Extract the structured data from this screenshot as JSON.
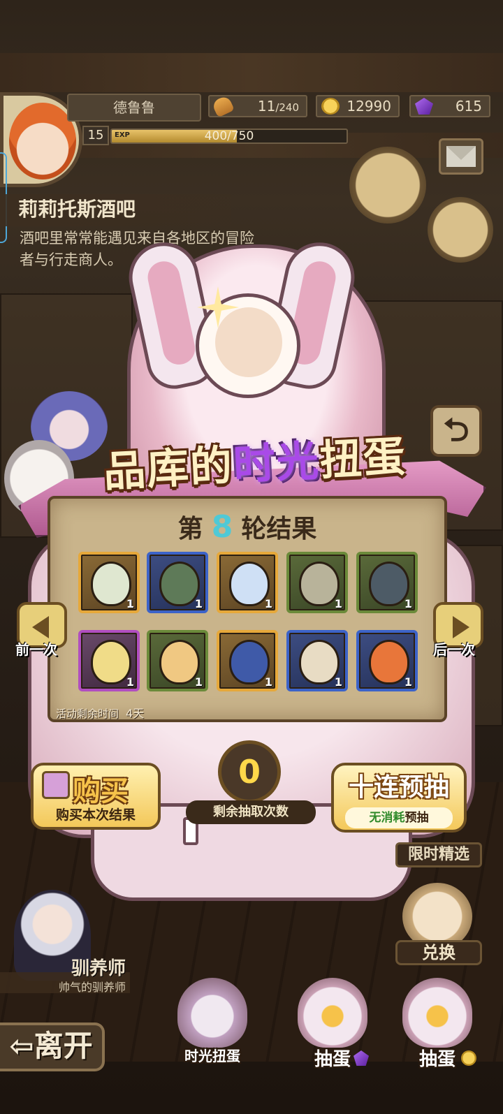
{
  "player": {
    "name": "德鲁鲁",
    "level": "15",
    "exp_tag": "EXP",
    "exp_text": "400/750",
    "exp_fraction": 0.533
  },
  "resources": {
    "bread_current": "11",
    "bread_max": "/240",
    "gold": "12990",
    "gems": "615"
  },
  "location": {
    "title": "莉莉托斯酒吧",
    "description": "酒吧里常常能遇见来自各地区的冒险者与行走商人。"
  },
  "event": {
    "title_prefix": "品库的",
    "title_highlight": "时光",
    "title_suffix": "扭蛋",
    "round_prefix": "第",
    "round_number": "8",
    "round_suffix": "轮结果",
    "remaining_label": "活动剩余时间",
    "remaining_value": "4天",
    "prev_label": "前一次",
    "next_label": "后一次",
    "results": [
      {
        "frame": "gold",
        "icon": "leaf-egg-icon",
        "qty": "1",
        "color": "#dfe7d0"
      },
      {
        "frame": "blue",
        "icon": "hooded-egg-icon",
        "qty": "1",
        "color": "#5e7a58"
      },
      {
        "frame": "gold",
        "icon": "winged-crown-egg-icon",
        "qty": "1",
        "color": "#cfe0f5"
      },
      {
        "frame": "green",
        "icon": "seed-egg-icon",
        "qty": "1",
        "color": "#b8b39a"
      },
      {
        "frame": "green",
        "icon": "shell-egg-icon",
        "qty": "1",
        "color": "#4d5b66"
      },
      {
        "frame": "purple",
        "icon": "golden-armor-egg-icon",
        "qty": "1",
        "color": "#f0dc88"
      },
      {
        "frame": "green",
        "icon": "striped-egg-icon",
        "qty": "1",
        "color": "#f0c882"
      },
      {
        "frame": "gold",
        "icon": "blue-fang-egg-icon",
        "qty": "1",
        "color": "#3f5aa8"
      },
      {
        "frame": "blue",
        "icon": "bearded-beast-egg-icon",
        "qty": "1",
        "color": "#e8dcc4"
      },
      {
        "frame": "blue",
        "icon": "flame-egg-icon",
        "qty": "1",
        "color": "#e8763a"
      }
    ]
  },
  "actions": {
    "buy_main": "购买",
    "buy_sub": "购买本次结果",
    "draw_count": "0",
    "draw_count_label": "剩余抽取次数",
    "ten_main": "十连预抽",
    "ten_free": "无消耗",
    "ten_sub_suffix": "预抽"
  },
  "side": {
    "limited_label": "限时精选",
    "exchange_label": "兑换",
    "trainer_name": "驯养师",
    "trainer_title": "帅气的驯养师"
  },
  "bottom": {
    "leave_label": "离开",
    "tabs": [
      "时光扭蛋",
      "抽蛋",
      "抽蛋"
    ]
  },
  "colors": {
    "accent_gold": "#f3c85a",
    "round_number": "#4fc9d6",
    "count_yellow": "#ffd84a",
    "highlight_purple": "#a94ae8"
  }
}
